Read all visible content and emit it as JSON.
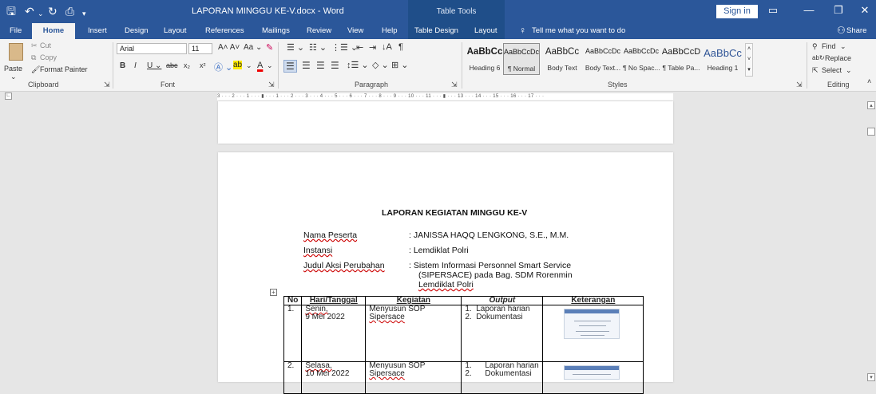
{
  "window": {
    "title": "LAPORAN MINGGU KE-V.docx  -  Word",
    "context_tab": "Table Tools",
    "signin": "Sign in"
  },
  "tabs": [
    "File",
    "Home",
    "Insert",
    "Design",
    "Layout",
    "References",
    "Mailings",
    "Review",
    "View",
    "Help",
    "Table Design",
    "Layout"
  ],
  "tell_me": "Tell me what you want to do",
  "share": "Share",
  "clipboard": {
    "paste": "Paste",
    "cut": "Cut",
    "copy": "Copy",
    "format_painter": "Format Painter",
    "label": "Clipboard"
  },
  "font": {
    "name": "Arial",
    "size": "11",
    "label": "Font"
  },
  "paragraph": {
    "label": "Paragraph"
  },
  "styles": {
    "label": "Styles",
    "items": [
      {
        "sample": "AaBbCc",
        "name": "Heading 6"
      },
      {
        "sample": "AaBbCcDc",
        "name": "¶ Normal"
      },
      {
        "sample": "AaBbCc",
        "name": "Body Text"
      },
      {
        "sample": "AaBbCcDc",
        "name": "Body Text..."
      },
      {
        "sample": "AaBbCcDc",
        "name": "¶ No Spac..."
      },
      {
        "sample": "AaBbCcD",
        "name": "¶ Table Pa..."
      },
      {
        "sample": "AaBbCc",
        "name": "Heading 1"
      }
    ]
  },
  "editing": {
    "find": "Find",
    "replace": "Replace",
    "select": "Select",
    "label": "Editing"
  },
  "ruler": "3 · · · 2 · · · 1 · · · ▮ · · · 1 · · · 2 · · · 3 · · · 4 · · · 5 · · · 6 · · · 7 · · · 8 · · · 9 · · · 10 · · · 11 · · · ▮ · · · 13 · · · 14 · · · 15 · · · 16 · · · 17 · · ·",
  "document": {
    "heading": "LAPORAN KEGIATAN MINGGU KE-V",
    "fields": [
      {
        "label": "Nama Peserta",
        "value": ": JANISSA HAQQ LENGKONG, S.E., M.M."
      },
      {
        "label": "Instansi",
        "value": ": Lemdiklat Polri"
      },
      {
        "label": "Judul Aksi Perubahan",
        "value": ": Sistem  Informasi  Personnel  Smart  Service"
      }
    ],
    "value_line2": "(SIPERSACE)   pada   Bag.   SDM   Rorenmin",
    "value_line3": "Lemdiklat Polri",
    "table": {
      "headers": [
        "No",
        "Hari/Tanggal",
        "Kegiatan",
        "Output",
        "Keterangan"
      ],
      "rows": [
        {
          "no": "1.",
          "day": "Senin,",
          "date": "9 Mei 2022",
          "activity1": "Menyusun SOP",
          "activity2": "Sipersace",
          "out1": "1.  Laporan harian",
          "out2": "2.  Dokumentasi"
        },
        {
          "no": "2.",
          "day": "Selasa,",
          "date": "10 Mei 2022",
          "activity1": "Menyusun SOP",
          "activity2": "Sipersace",
          "out1": "1.      Laporan harian",
          "out2": "2.      Dokumentasi"
        }
      ]
    }
  }
}
